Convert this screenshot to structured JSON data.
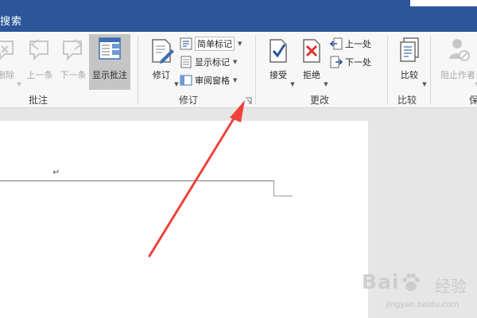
{
  "titlebar": {
    "title": "搜索"
  },
  "ribbon": {
    "comments_group": {
      "label": "批注",
      "delete_label": "删除",
      "previous_label": "上一条",
      "next_label": "下一条",
      "show_comments_label": "显示批注"
    },
    "tracking_group": {
      "label": "修订",
      "track_changes_label": "修订",
      "markup_view": "简单标记",
      "show_markup_label": "显示标记",
      "reviewing_pane_label": "审阅窗格"
    },
    "changes_group": {
      "label": "更改",
      "accept_label": "接受",
      "reject_label": "拒绝",
      "previous_change_label": "上一处",
      "next_change_label": "下一处"
    },
    "compare_group": {
      "label": "比较",
      "compare_label": "比较"
    },
    "protect_group": {
      "label": "保",
      "block_authors_label": "阻止作者"
    }
  },
  "document": {
    "paragraph_mark": "↵"
  },
  "watermark": {
    "brand": "Bai",
    "brand_cn": "经验",
    "url": "jingyan.baidu.com"
  },
  "colors": {
    "titlebar": "#2b579a",
    "ribbon": "#f7f7f7",
    "canvas": "#e6e6e6",
    "arrow": "#f0413a",
    "accent_blue": "#2b579a"
  }
}
